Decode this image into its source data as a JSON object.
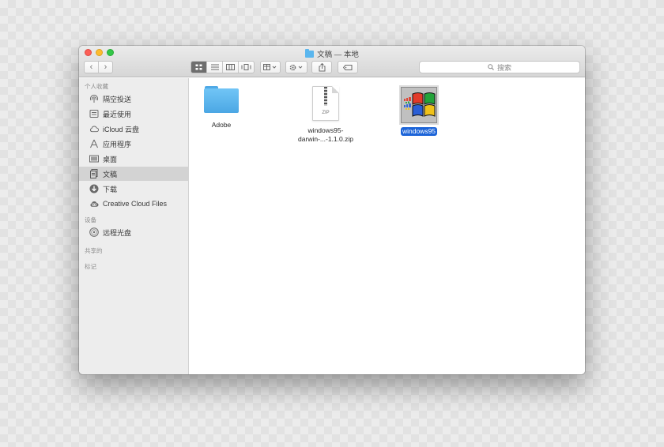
{
  "window": {
    "title": "文稿 — 本地"
  },
  "toolbar": {
    "back_glyph": "‹",
    "forward_glyph": "›",
    "search_placeholder": "搜索",
    "icons": [
      "icon-view-icon",
      "list-view-icon",
      "column-view-icon",
      "cover-flow-icon",
      "arrange-icon",
      "gear-icon",
      "share-icon",
      "tag-icon",
      "search-icon"
    ]
  },
  "sidebar": {
    "favorites_header": "个人收藏",
    "favorites": [
      {
        "label": "隔空投送",
        "icon": "airdrop-icon"
      },
      {
        "label": "最近使用",
        "icon": "recents-icon"
      },
      {
        "label": "iCloud 云盘",
        "icon": "cloud-icon"
      },
      {
        "label": "应用程序",
        "icon": "applications-icon"
      },
      {
        "label": "桌面",
        "icon": "desktop-icon"
      },
      {
        "label": "文稿",
        "icon": "documents-icon",
        "selected": true
      },
      {
        "label": "下载",
        "icon": "downloads-icon"
      },
      {
        "label": "Creative Cloud Files",
        "icon": "creative-cloud-icon"
      }
    ],
    "devices_header": "设备",
    "devices": [
      {
        "label": "远程光盘",
        "icon": "disc-icon"
      }
    ],
    "shared_header": "共享的",
    "tags_header": "标记"
  },
  "files": [
    {
      "name_line1": "Adobe",
      "type": "folder"
    },
    {
      "name_line1": "windows95-",
      "name_line2": "darwin-...-1.1.0.zip",
      "type": "zip",
      "zip_label": "ZIP"
    },
    {
      "name_line1": "windows95",
      "type": "app",
      "selected": true
    }
  ],
  "colors": {
    "selection": "#1c64d8",
    "folder": "#5ab6ee",
    "close": "#fc5f57",
    "minimize": "#fdbc2e",
    "maximize": "#33c748"
  }
}
